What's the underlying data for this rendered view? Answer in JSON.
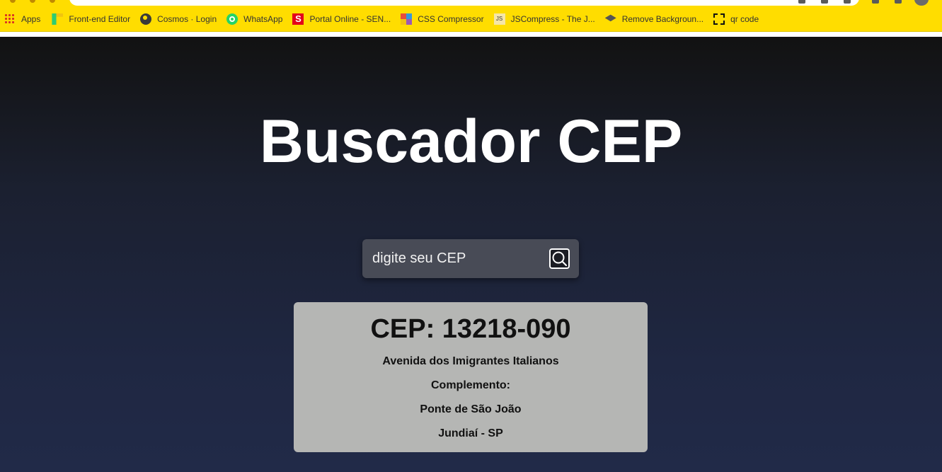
{
  "browser": {
    "bookmarks": [
      {
        "label": "Apps",
        "icon": "apps-grid-icon"
      },
      {
        "label": "Front-end Editor",
        "icon": "frontend-editor-icon"
      },
      {
        "label": "Cosmos · Login",
        "icon": "globe-icon"
      },
      {
        "label": "WhatsApp",
        "icon": "whatsapp-icon"
      },
      {
        "label": "Portal Online - SEN...",
        "icon": "senai-icon"
      },
      {
        "label": "CSS Compressor",
        "icon": "css-compressor-icon"
      },
      {
        "label": "JSCompress - The J...",
        "icon": "jscompress-icon"
      },
      {
        "label": "Remove Backgroun...",
        "icon": "remove-bg-icon"
      },
      {
        "label": "qr code",
        "icon": "qr-code-icon"
      }
    ],
    "colors": {
      "bookmarks_bar": "#ffdd00"
    }
  },
  "page": {
    "title": "Buscador CEP",
    "search": {
      "placeholder": "digite seu CEP",
      "value": "",
      "button_icon": "search-icon"
    },
    "result": {
      "cep": "CEP: 13218-090",
      "logradouro": "Avenida dos Imigrantes Italianos",
      "complemento": "Complemento:",
      "bairro": "Ponte de São João",
      "cidade_uf": "Jundiaí - SP"
    },
    "colors": {
      "background_top": "#121212",
      "background_bottom": "#212a48",
      "search_box": "#484b56",
      "result_card": "#b5b6b4",
      "title_text": "#ffffff"
    }
  }
}
